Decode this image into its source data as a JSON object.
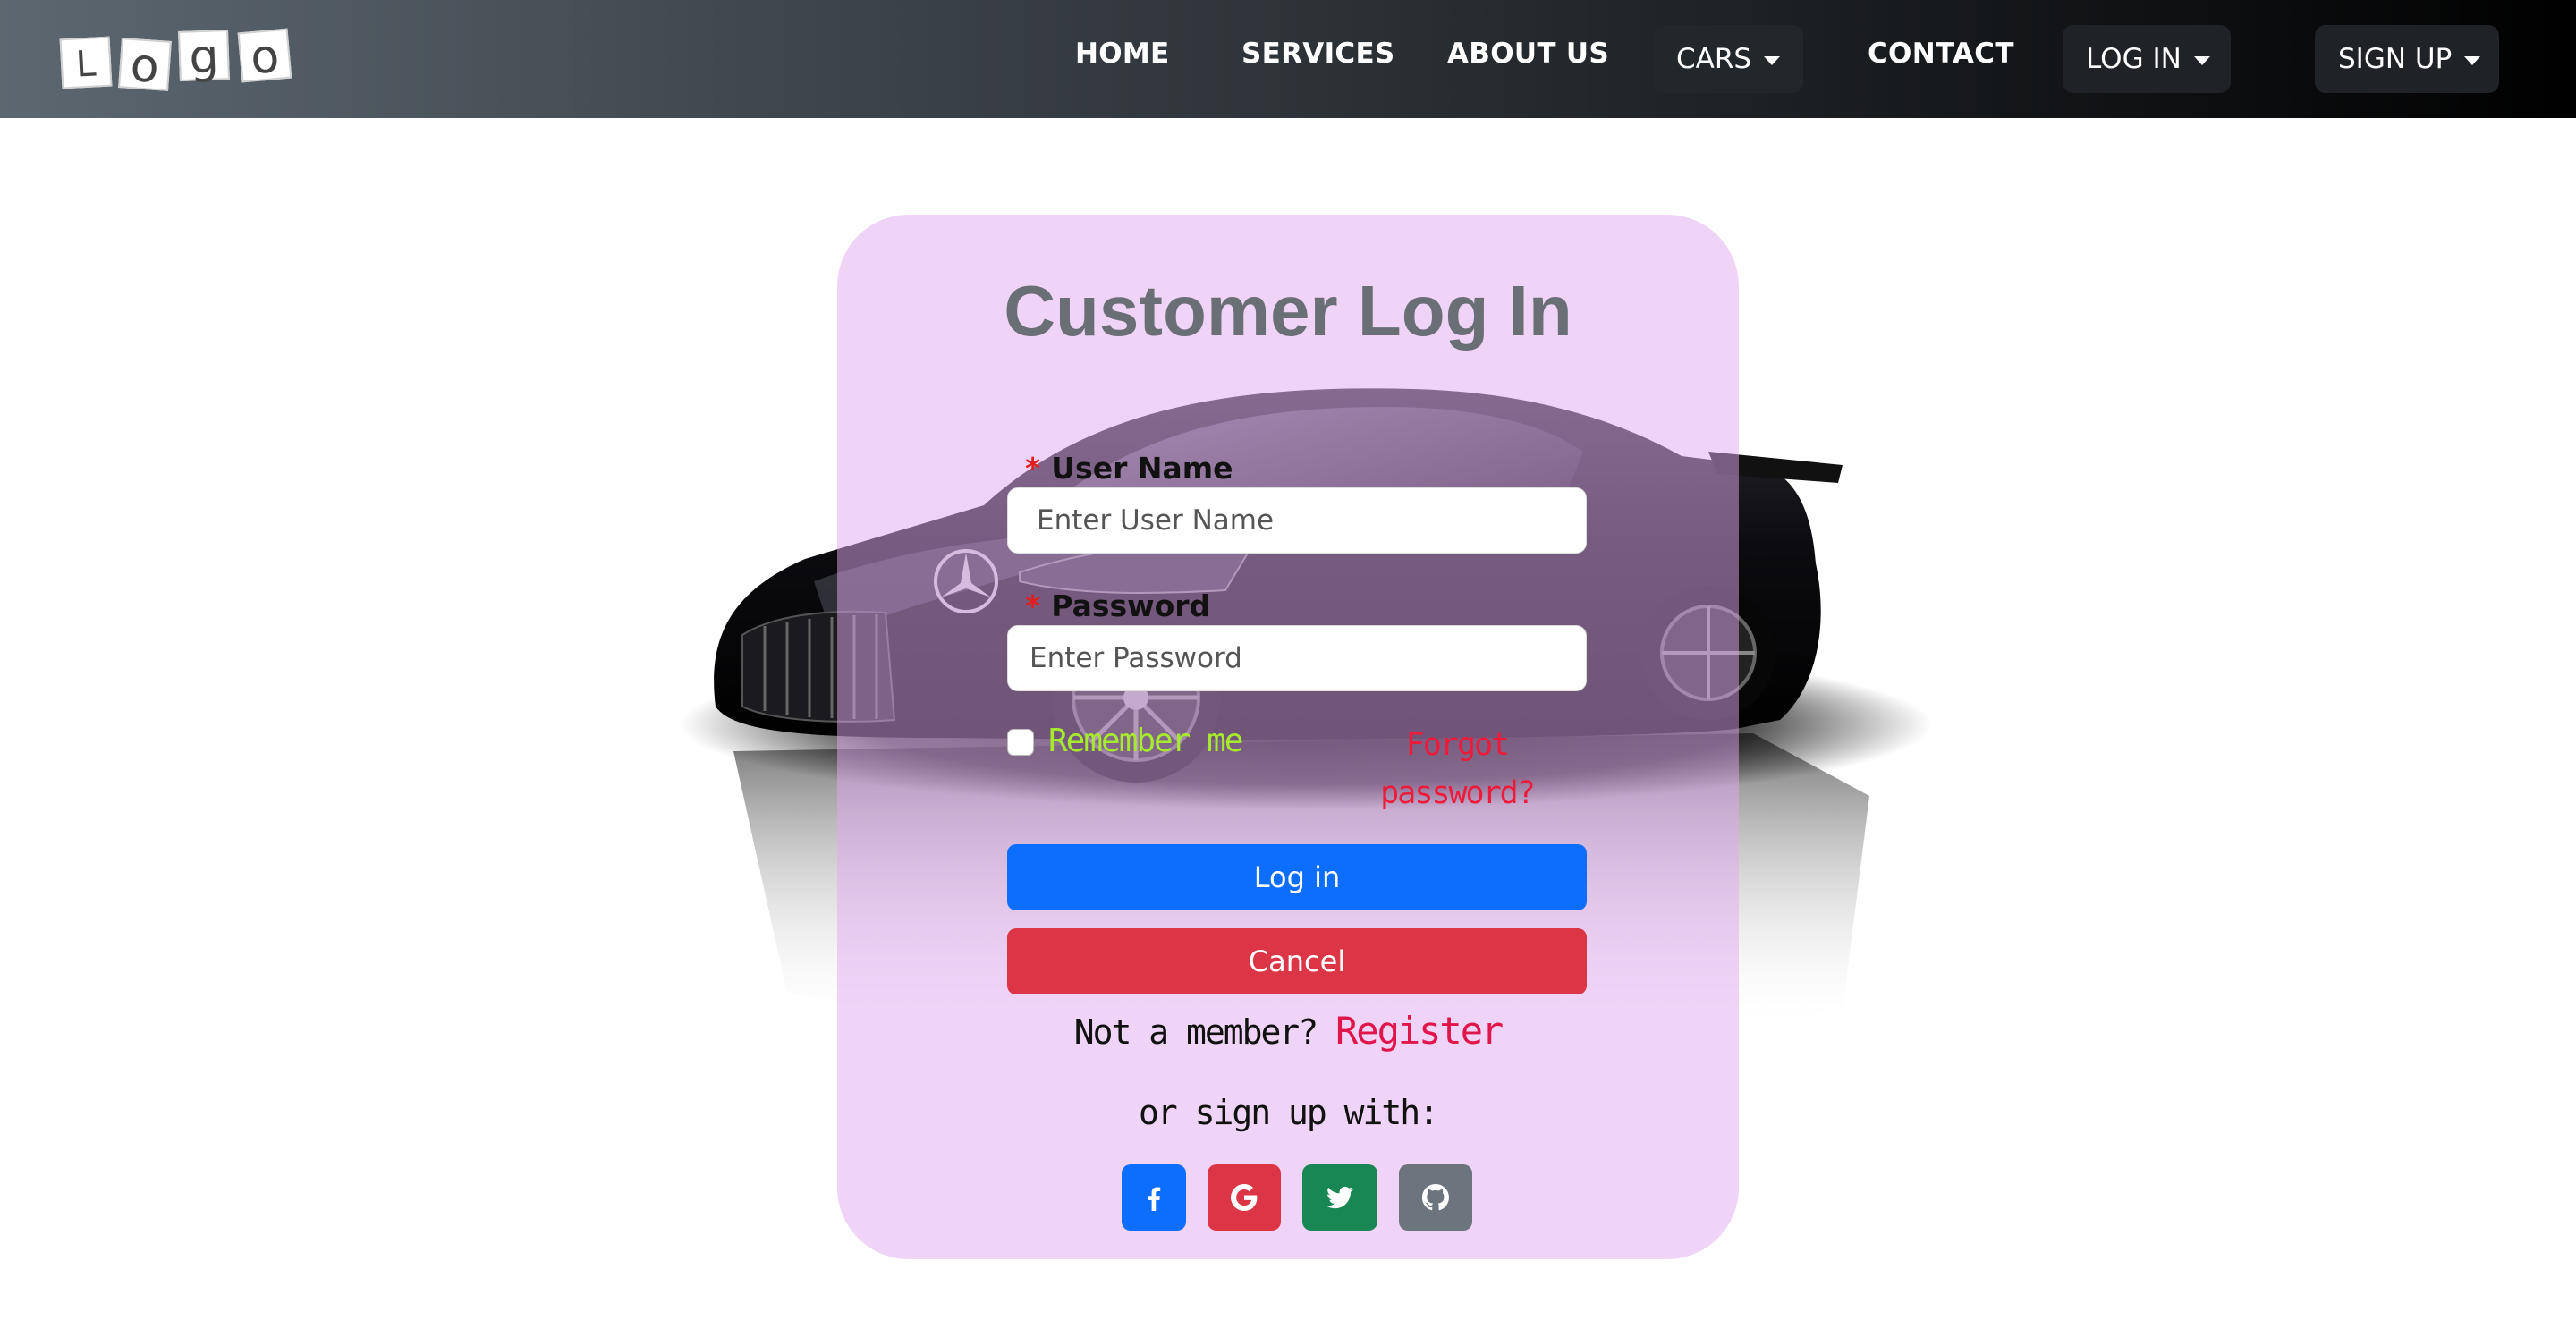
{
  "brand": {
    "logo_letters": [
      "L",
      "o",
      "g",
      "o"
    ]
  },
  "nav": {
    "home": "HOME",
    "services": "SERVICES",
    "about": "ABOUT US",
    "cars": "CARS",
    "contact": "CONTACT",
    "login": "LOG IN",
    "signup": "SIGN UP"
  },
  "login_form": {
    "title": "Customer Log In",
    "required_mark": "*",
    "username_label": "User Name",
    "username_placeholder": "Enter User Name",
    "password_label": "Password",
    "password_placeholder": "Enter Password",
    "remember_label": "Remember me",
    "remember_checked": false,
    "forgot_link": "Forgot password?",
    "login_button": "Log in",
    "cancel_button": "Cancel",
    "not_member_text": "Not a member?",
    "register_link": "Register",
    "signup_with_text": "or sign up with:"
  },
  "social": [
    {
      "name": "facebook",
      "icon": "facebook-icon",
      "color": "#0d6efd"
    },
    {
      "name": "google",
      "icon": "google-icon",
      "color": "#dc3545"
    },
    {
      "name": "twitter",
      "icon": "twitter-icon",
      "color": "#198754"
    },
    {
      "name": "github",
      "icon": "github-icon",
      "color": "#6c757d"
    }
  ],
  "colors": {
    "card_bg": "#f0d5f8",
    "primary": "#0d6efd",
    "danger": "#dc3545",
    "remember_text": "#a6ea2e",
    "forgot_text": "#ee1a3a",
    "register_text": "#e0154a"
  }
}
